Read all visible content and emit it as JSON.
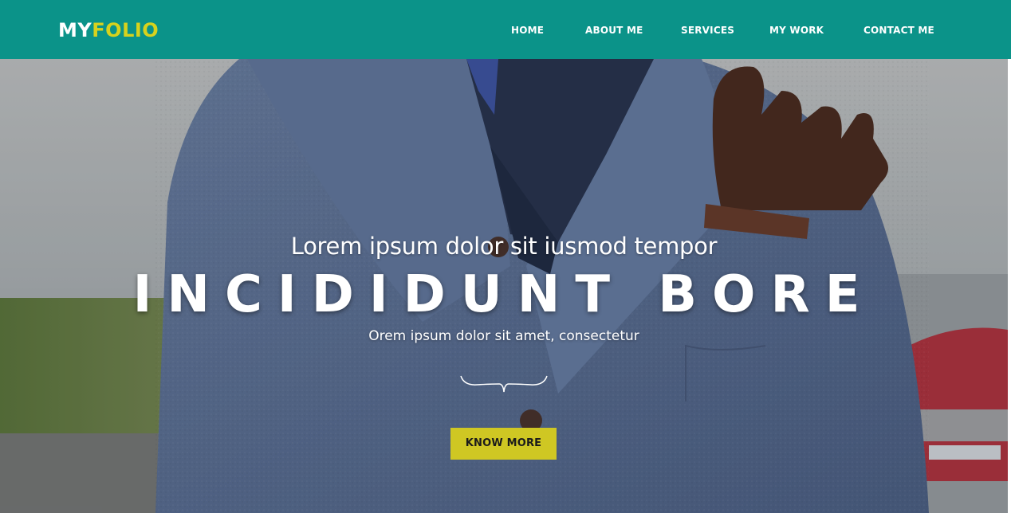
{
  "header": {
    "logo_part1": "MY",
    "logo_part2": "FOLIO",
    "nav": [
      {
        "label": "HOME"
      },
      {
        "label": "ABOUT ME"
      },
      {
        "label": "SERVICES"
      },
      {
        "label": "MY WORK"
      },
      {
        "label": "CONTACT ME"
      }
    ]
  },
  "hero": {
    "subtitle": "Lorem ipsum dolor sit iusmod tempor",
    "title": "INCIDIDUNT BORE",
    "tagline": "Orem ipsum dolor sit amet, consectetur",
    "button_label": "KNOW MORE"
  },
  "colors": {
    "header_bg": "#0b9389",
    "logo_accent": "#d7d21d",
    "button_bg": "#cfc723"
  }
}
